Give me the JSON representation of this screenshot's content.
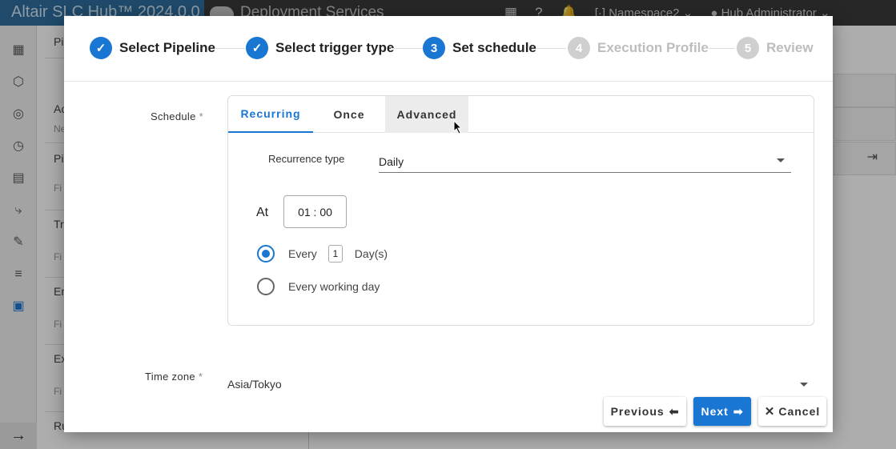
{
  "app": {
    "brand": "Altair SLC Hub™ 2024.0.0",
    "service": "Deployment Services",
    "namespace": "Namespace2",
    "user": "Hub Administrator"
  },
  "background_panel": {
    "labels": [
      "Pi",
      "Ac",
      "Ne",
      "Pi",
      "Fi",
      "Tr",
      "Fi",
      "En",
      "Fi",
      "Ex",
      "Fi",
      "Ru"
    ]
  },
  "stepper": {
    "steps": [
      {
        "number": "",
        "label": "Select Pipeline",
        "state": "done"
      },
      {
        "number": "",
        "label": "Select trigger type",
        "state": "done"
      },
      {
        "number": "3",
        "label": "Set schedule",
        "state": "current"
      },
      {
        "number": "4",
        "label": "Execution Profile",
        "state": "todo"
      },
      {
        "number": "5",
        "label": "Review",
        "state": "todo"
      }
    ]
  },
  "schedule": {
    "label": "Schedule",
    "required_mark": "*",
    "tabs": [
      "Recurring",
      "Once",
      "Advanced"
    ],
    "active_tab": "Recurring",
    "recurrence_type_label": "Recurrence type",
    "recurrence_type_value": "Daily",
    "at_label": "At",
    "time_value": "01 : 00",
    "every_label": "Every",
    "every_value": "1",
    "every_unit": "Day(s)",
    "every_working_day_label": "Every working day",
    "selected_option": "every"
  },
  "timezone": {
    "label": "Time zone",
    "required_mark": "*",
    "value": "Asia/Tokyo"
  },
  "buttons": {
    "previous": "Previous",
    "next": "Next",
    "cancel": "Cancel"
  },
  "colors": {
    "accent": "#1976d2",
    "brand_bar": "#2f6e9e",
    "topbar": "#3a3a3a"
  }
}
